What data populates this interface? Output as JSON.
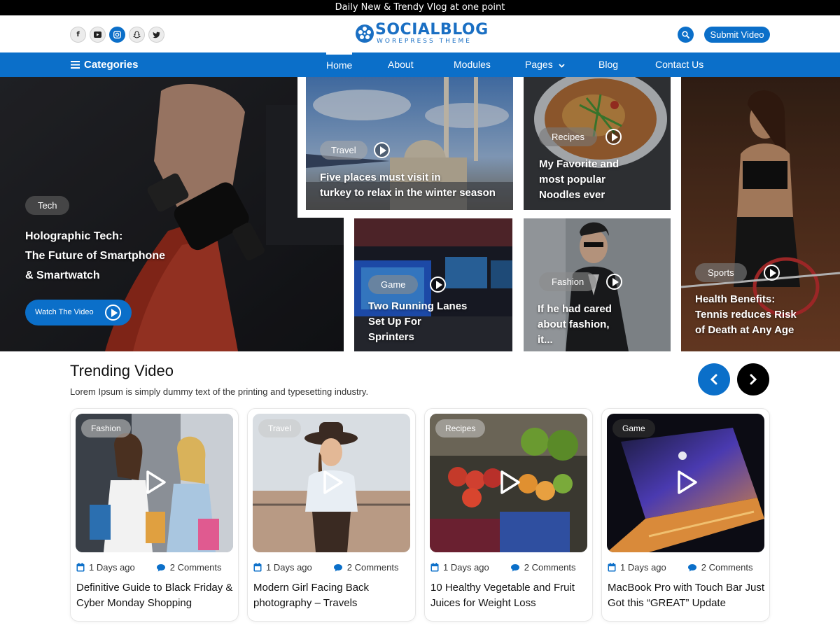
{
  "topbar": {
    "text": "Daily New & Trendy Vlog at one point"
  },
  "header": {
    "socials": [
      "facebook-icon",
      "youtube-icon",
      "instagram-icon",
      "snapchat-icon",
      "twitter-icon"
    ],
    "logo_title": "SOCIALBLOG",
    "logo_subtitle": "WOREPRESS THEME",
    "submit_label": "Submit Video"
  },
  "nav": {
    "categories_label": "Categories",
    "items": [
      "Home",
      "About",
      "Modules",
      "Pages",
      "Blog",
      "Contact Us"
    ],
    "active": "Home"
  },
  "hero": {
    "main": {
      "tag": "Tech",
      "title_lines": [
        "Holographic Tech:",
        "The Future of Smartphone",
        "& Smartwatch"
      ],
      "button": "Watch The Video"
    },
    "tiles": [
      {
        "tag": "Travel",
        "title_lines": [
          "Five places must visit in",
          "turkey to relax in the winter season"
        ]
      },
      {
        "tag": "Recipes",
        "title_lines": [
          "My Favorite and",
          "most popular",
          "Noodles ever"
        ]
      },
      {
        "tag": "Game",
        "title_lines": [
          "Two Running Lanes",
          "Set Up For",
          "Sprinters"
        ]
      },
      {
        "tag": "Fashion",
        "title_lines": [
          "If he had cared",
          "about fashion,",
          "it..."
        ]
      },
      {
        "tag": "Sports",
        "title_lines": [
          "Health Benefits:",
          "Tennis reduces Risk",
          "of Death at Any Age"
        ]
      }
    ]
  },
  "trending": {
    "title": "Trending Video",
    "subtitle": "Lorem Ipsum is simply dummy text of the printing and typesetting industry.",
    "cards": [
      {
        "tag": "Fashion",
        "date": "1 Days ago",
        "comments": "2 Comments",
        "title": "Definitive Guide to Black Friday & Cyber Monday Shopping"
      },
      {
        "tag": "Travel",
        "date": "1 Days ago",
        "comments": "2 Comments",
        "title": "Modern Girl Facing Back photography – Travels"
      },
      {
        "tag": "Recipes",
        "date": "1 Days ago",
        "comments": "2 Comments",
        "title": "10 Healthy Vegetable and Fruit Juices for Weight Loss"
      },
      {
        "tag": "Game",
        "date": "1 Days ago",
        "comments": "2 Comments",
        "title": "MacBook Pro with Touch Bar Just Got this “GREAT” Update"
      }
    ]
  },
  "colors": {
    "brand": "#0b6fc9",
    "topbar": "#000000"
  }
}
